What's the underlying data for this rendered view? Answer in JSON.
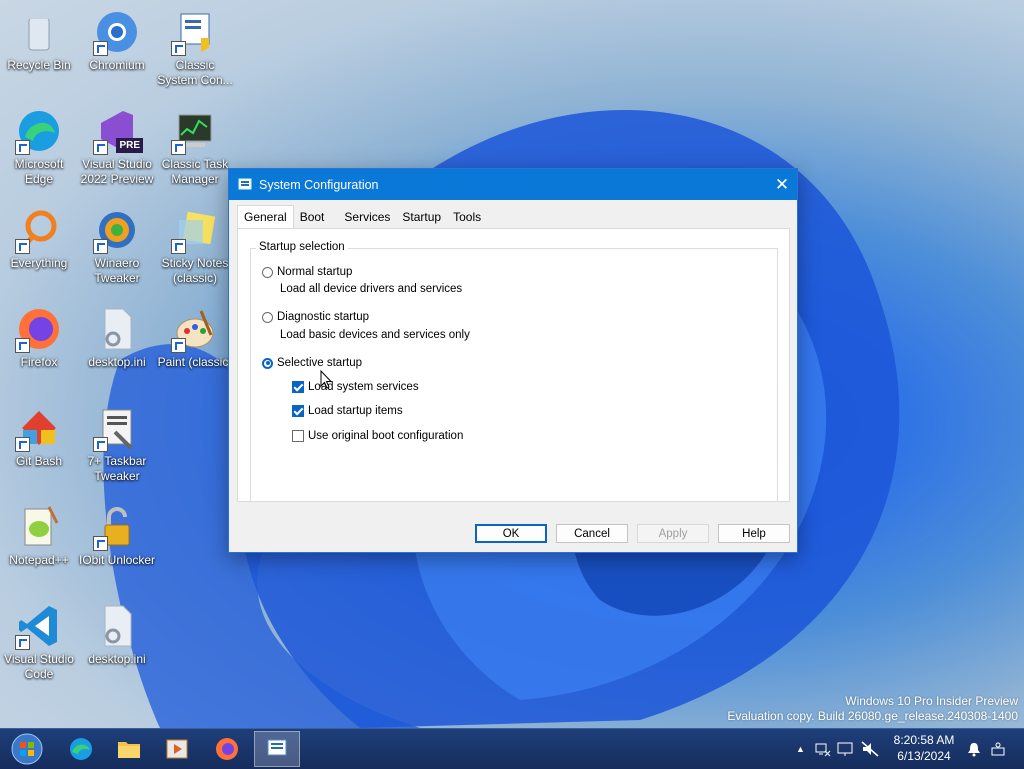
{
  "desktop": {
    "icons": [
      {
        "label": "Recycle Bin"
      },
      {
        "label": "Chromium"
      },
      {
        "label": "Classic System Con..."
      },
      {
        "label": "Microsoft Edge"
      },
      {
        "label": "Visual Studio 2022 Preview"
      },
      {
        "label": "Classic Task Manager"
      },
      {
        "label": "Everything"
      },
      {
        "label": "Winaero Tweaker"
      },
      {
        "label": "Sticky Notes (classic)"
      },
      {
        "label": "Firefox"
      },
      {
        "label": "desktop.ini"
      },
      {
        "label": "Paint (classic)"
      },
      {
        "label": "Git Bash"
      },
      {
        "label": "7+ Taskbar Tweaker"
      },
      {
        "label": "Notepad++"
      },
      {
        "label": "IObit Unlocker"
      },
      {
        "label": "Visual Studio Code"
      },
      {
        "label": "desktop.ini"
      }
    ],
    "vs_badge": "PRE",
    "watermark_line1": "Windows 10 Pro Insider Preview",
    "watermark_line2": "Evaluation copy. Build 26080.ge_release.240308-1400"
  },
  "dialog": {
    "title": "System Configuration",
    "close_glyph": "✕",
    "tabs": [
      "General",
      "Boot",
      "Services",
      "Startup",
      "Tools"
    ],
    "group_title": "Startup selection",
    "normal_label": "Normal startup",
    "normal_desc": "Load all device drivers and services",
    "diagnostic_label": "Diagnostic startup",
    "diagnostic_desc": "Load basic devices and services only",
    "selective_label": "Selective startup",
    "load_system_services": "Load system services",
    "load_startup_items": "Load startup items",
    "use_original_boot": "Use original boot configuration",
    "buttons": {
      "ok": "OK",
      "cancel": "Cancel",
      "apply": "Apply",
      "help": "Help"
    }
  },
  "taskbar": {
    "time": "8:20:58 AM",
    "date": "6/13/2024",
    "tray_arrow": "▲"
  },
  "colors": {
    "accent": "#0a78d7",
    "taskbar": "#1f3f7a"
  }
}
